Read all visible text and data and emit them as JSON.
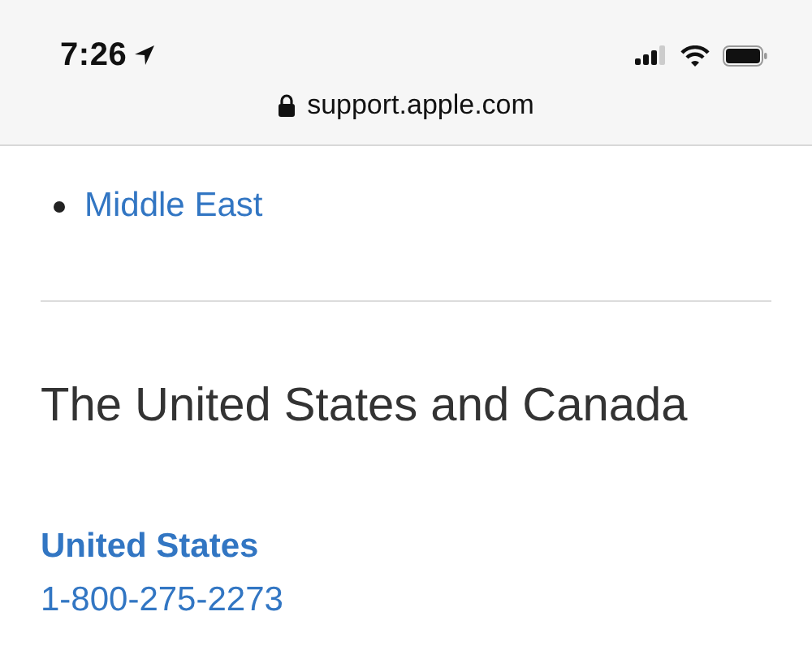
{
  "status_bar": {
    "time": "7:26"
  },
  "address_bar": {
    "url": "support.apple.com"
  },
  "regions": [
    {
      "label": "Middle East"
    }
  ],
  "section": {
    "heading": "The United States and Canada",
    "countries": [
      {
        "name": "United States",
        "phone": "1-800-275-2273"
      }
    ]
  }
}
